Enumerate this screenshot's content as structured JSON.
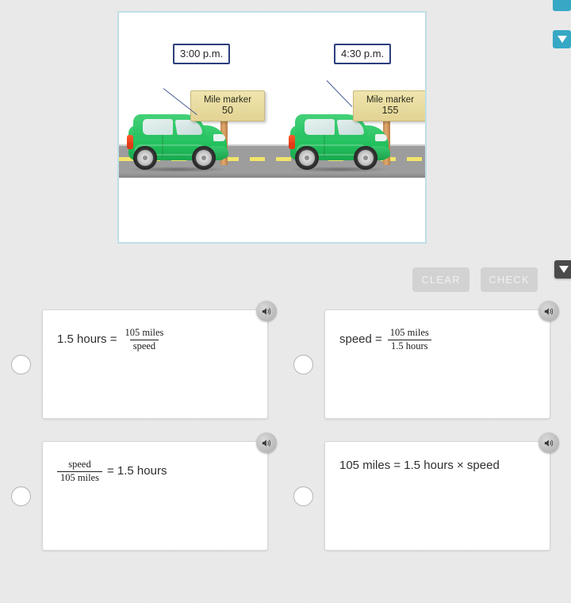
{
  "page": {
    "background_color": "#ececec",
    "accent_teal": "#36a8c5"
  },
  "edge_widgets": {
    "top_tab_name": "panel-tab",
    "top_collapse_icon": "chevron-down-icon",
    "mid_collapse_icon": "chevron-down-icon"
  },
  "stimulus": {
    "border_color": "#bfdfe6",
    "cars": [
      {
        "time_label": "3:00 p.m.",
        "marker_title": "Mile marker",
        "marker_value": "50"
      },
      {
        "time_label": "4:30 p.m.",
        "marker_title": "Mile marker",
        "marker_value": "155"
      }
    ]
  },
  "toolbar": {
    "clear_label": "CLEAR",
    "check_label": "CHECK"
  },
  "options": [
    {
      "id": "option-a",
      "selected": false,
      "lead_text": "1.5 hours =",
      "fraction": {
        "numerator": "105 miles",
        "denominator": "speed"
      },
      "trail_text": "",
      "plain_text": "",
      "fraction_first": false,
      "speaker_icon": "speaker-icon"
    },
    {
      "id": "option-b",
      "selected": false,
      "lead_text": "speed =",
      "fraction": {
        "numerator": "105 miles",
        "denominator": "1.5 hours"
      },
      "trail_text": "",
      "plain_text": "",
      "fraction_first": false,
      "speaker_icon": "speaker-icon"
    },
    {
      "id": "option-c",
      "selected": false,
      "lead_text": "",
      "fraction": {
        "numerator": "speed",
        "denominator": "105 miles"
      },
      "trail_text": "= 1.5 hours",
      "plain_text": "",
      "fraction_first": true,
      "speaker_icon": "speaker-icon"
    },
    {
      "id": "option-d",
      "selected": false,
      "lead_text": "",
      "fraction": null,
      "trail_text": "",
      "plain_text": "105 miles = 1.5 hours × speed",
      "fraction_first": false,
      "speaker_icon": "speaker-icon"
    }
  ]
}
